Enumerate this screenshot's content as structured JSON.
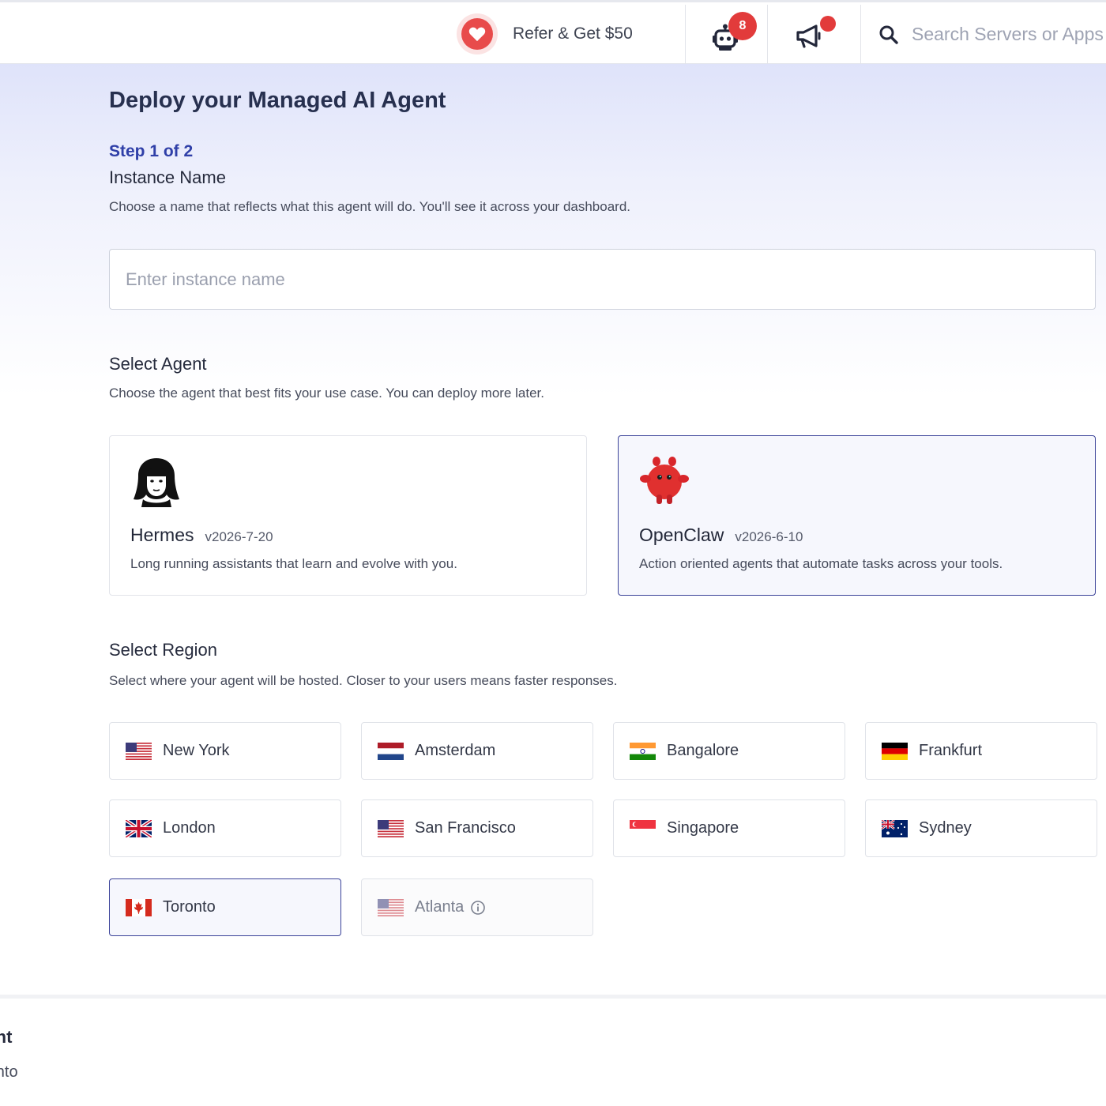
{
  "header": {
    "refer_label": "Refer & Get $50",
    "bot_badge_count": "8",
    "search_placeholder": "Search Servers or Apps",
    "icons": [
      "heart-icon",
      "robot-icon",
      "megaphone-icon",
      "search-icon"
    ],
    "colors": {
      "badge": "#e23b3b",
      "heart": "#e84b4b"
    }
  },
  "page": {
    "title": "Deploy your Managed AI Agent",
    "step": "Step 1 of 2",
    "instance": {
      "title": "Instance Name",
      "description": "Choose a name that reflects what this agent will do. You'll see it across your dashboard.",
      "placeholder": "Enter instance name",
      "value": ""
    },
    "agent": {
      "title": "Select Agent",
      "description": "Choose the agent that best fits your use case. You can deploy more later.",
      "options": [
        {
          "name": "Hermes",
          "version": "v2026-7-20",
          "description": "Long running assistants that learn and evolve with you.",
          "selected": false
        },
        {
          "name": "OpenClaw",
          "version": "v2026-6-10",
          "description": "Action oriented agents that automate tasks across your tools.",
          "selected": true
        }
      ]
    },
    "region": {
      "title": "Select Region",
      "description": "Select where your agent will be hosted. Closer to your users means faster responses.",
      "options": [
        {
          "label": "New York",
          "flag": "us"
        },
        {
          "label": "Amsterdam",
          "flag": "nl"
        },
        {
          "label": "Bangalore",
          "flag": "in"
        },
        {
          "label": "Frankfurt",
          "flag": "de"
        },
        {
          "label": "London",
          "flag": "gb"
        },
        {
          "label": "San Francisco",
          "flag": "us"
        },
        {
          "label": "Singapore",
          "flag": "sg"
        },
        {
          "label": "Sydney",
          "flag": "au"
        },
        {
          "label": "Toronto",
          "flag": "ca",
          "selected": true
        },
        {
          "label": "Atlanta",
          "flag": "us",
          "disabled": true
        }
      ]
    }
  },
  "footer": {
    "title": "gent",
    "subtitle": "ronto"
  },
  "colors": {
    "accent": "#3b4399",
    "step": "#2f3fa8"
  }
}
